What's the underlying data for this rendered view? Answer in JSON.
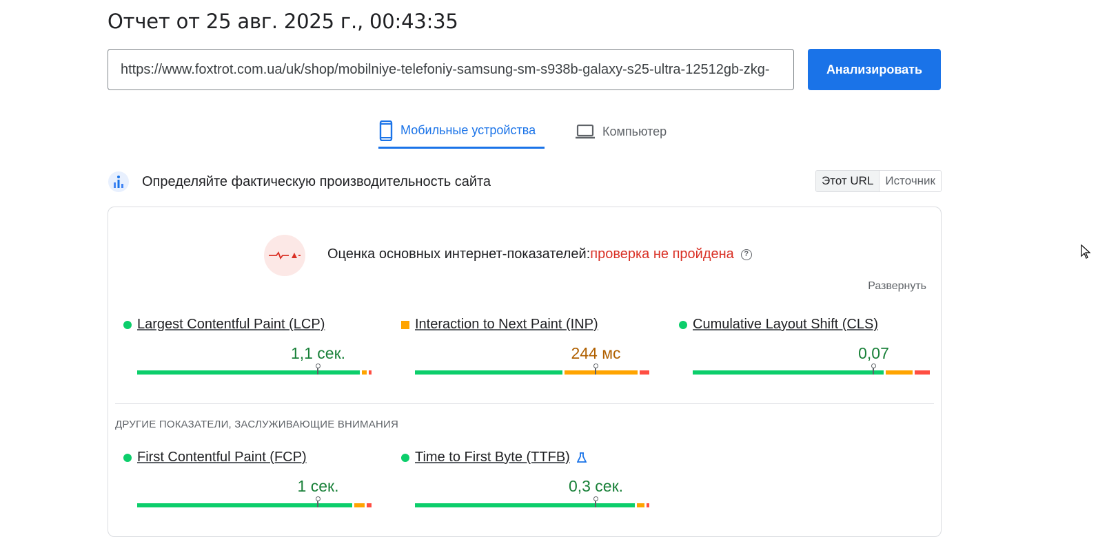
{
  "report": {
    "title": "Отчет от 25 авг. 2025 г., 00:43:35"
  },
  "search": {
    "url": "https://www.foxtrot.com.ua/uk/shop/mobilniye-telefoniy-samsung-sm-s938b-galaxy-s25-ultra-12512gb-zkg-",
    "analyze_label": "Анализировать"
  },
  "tabs": [
    {
      "label": "Мобильные устройства",
      "icon": "smartphone-icon",
      "active": true
    },
    {
      "label": "Компьютер",
      "icon": "laptop-icon",
      "active": false
    }
  ],
  "crux": {
    "heading": "Определяйте фактическую производительность сайта",
    "toggle": [
      "Этот URL",
      "Источник"
    ]
  },
  "assessment": {
    "label": "Оценка основных интернет-показателей:",
    "status": "проверка не пройдена",
    "help_icon": "?",
    "expand_label": "Развернуть"
  },
  "core_metrics": [
    {
      "name": "Largest Contentful Paint (LCP)",
      "value": "1,1 сек.",
      "rating": "good",
      "marker_fraction": 0.75,
      "segments": [
        0.93,
        0.03,
        0.02
      ]
    },
    {
      "name": "Interaction to Next Paint (INP)",
      "value": "244 мс",
      "rating": "average",
      "marker_fraction": 0.75,
      "segments": [
        0.62,
        0.31,
        0.05
      ]
    },
    {
      "name": "Cumulative Layout Shift (CLS)",
      "value": "0,07",
      "rating": "good",
      "marker_fraction": 0.75,
      "segments": [
        0.8,
        0.12,
        0.07
      ]
    }
  ],
  "other_section_label": "ДРУГИЕ ПОКАЗАТЕЛИ, ЗАСЛУЖИВАЮЩИЕ ВНИМАНИЯ",
  "other_metrics": [
    {
      "name": "First Contentful Paint (FCP)",
      "value": "1 сек.",
      "rating": "good",
      "marker_fraction": 0.75,
      "segments": [
        0.9,
        0.05,
        0.03
      ]
    },
    {
      "name": "Time to First Byte (TTFB)",
      "value": "0,3 сек.",
      "rating": "good",
      "marker_fraction": 0.75,
      "segments": [
        0.92,
        0.04,
        0.02
      ],
      "lab_icon": "flask-icon"
    }
  ],
  "colors": {
    "accent": "#1a73e8",
    "good": "#0cce6b",
    "average": "#ffa400",
    "poor": "#ff4e42",
    "fail_text": "#d93025"
  }
}
